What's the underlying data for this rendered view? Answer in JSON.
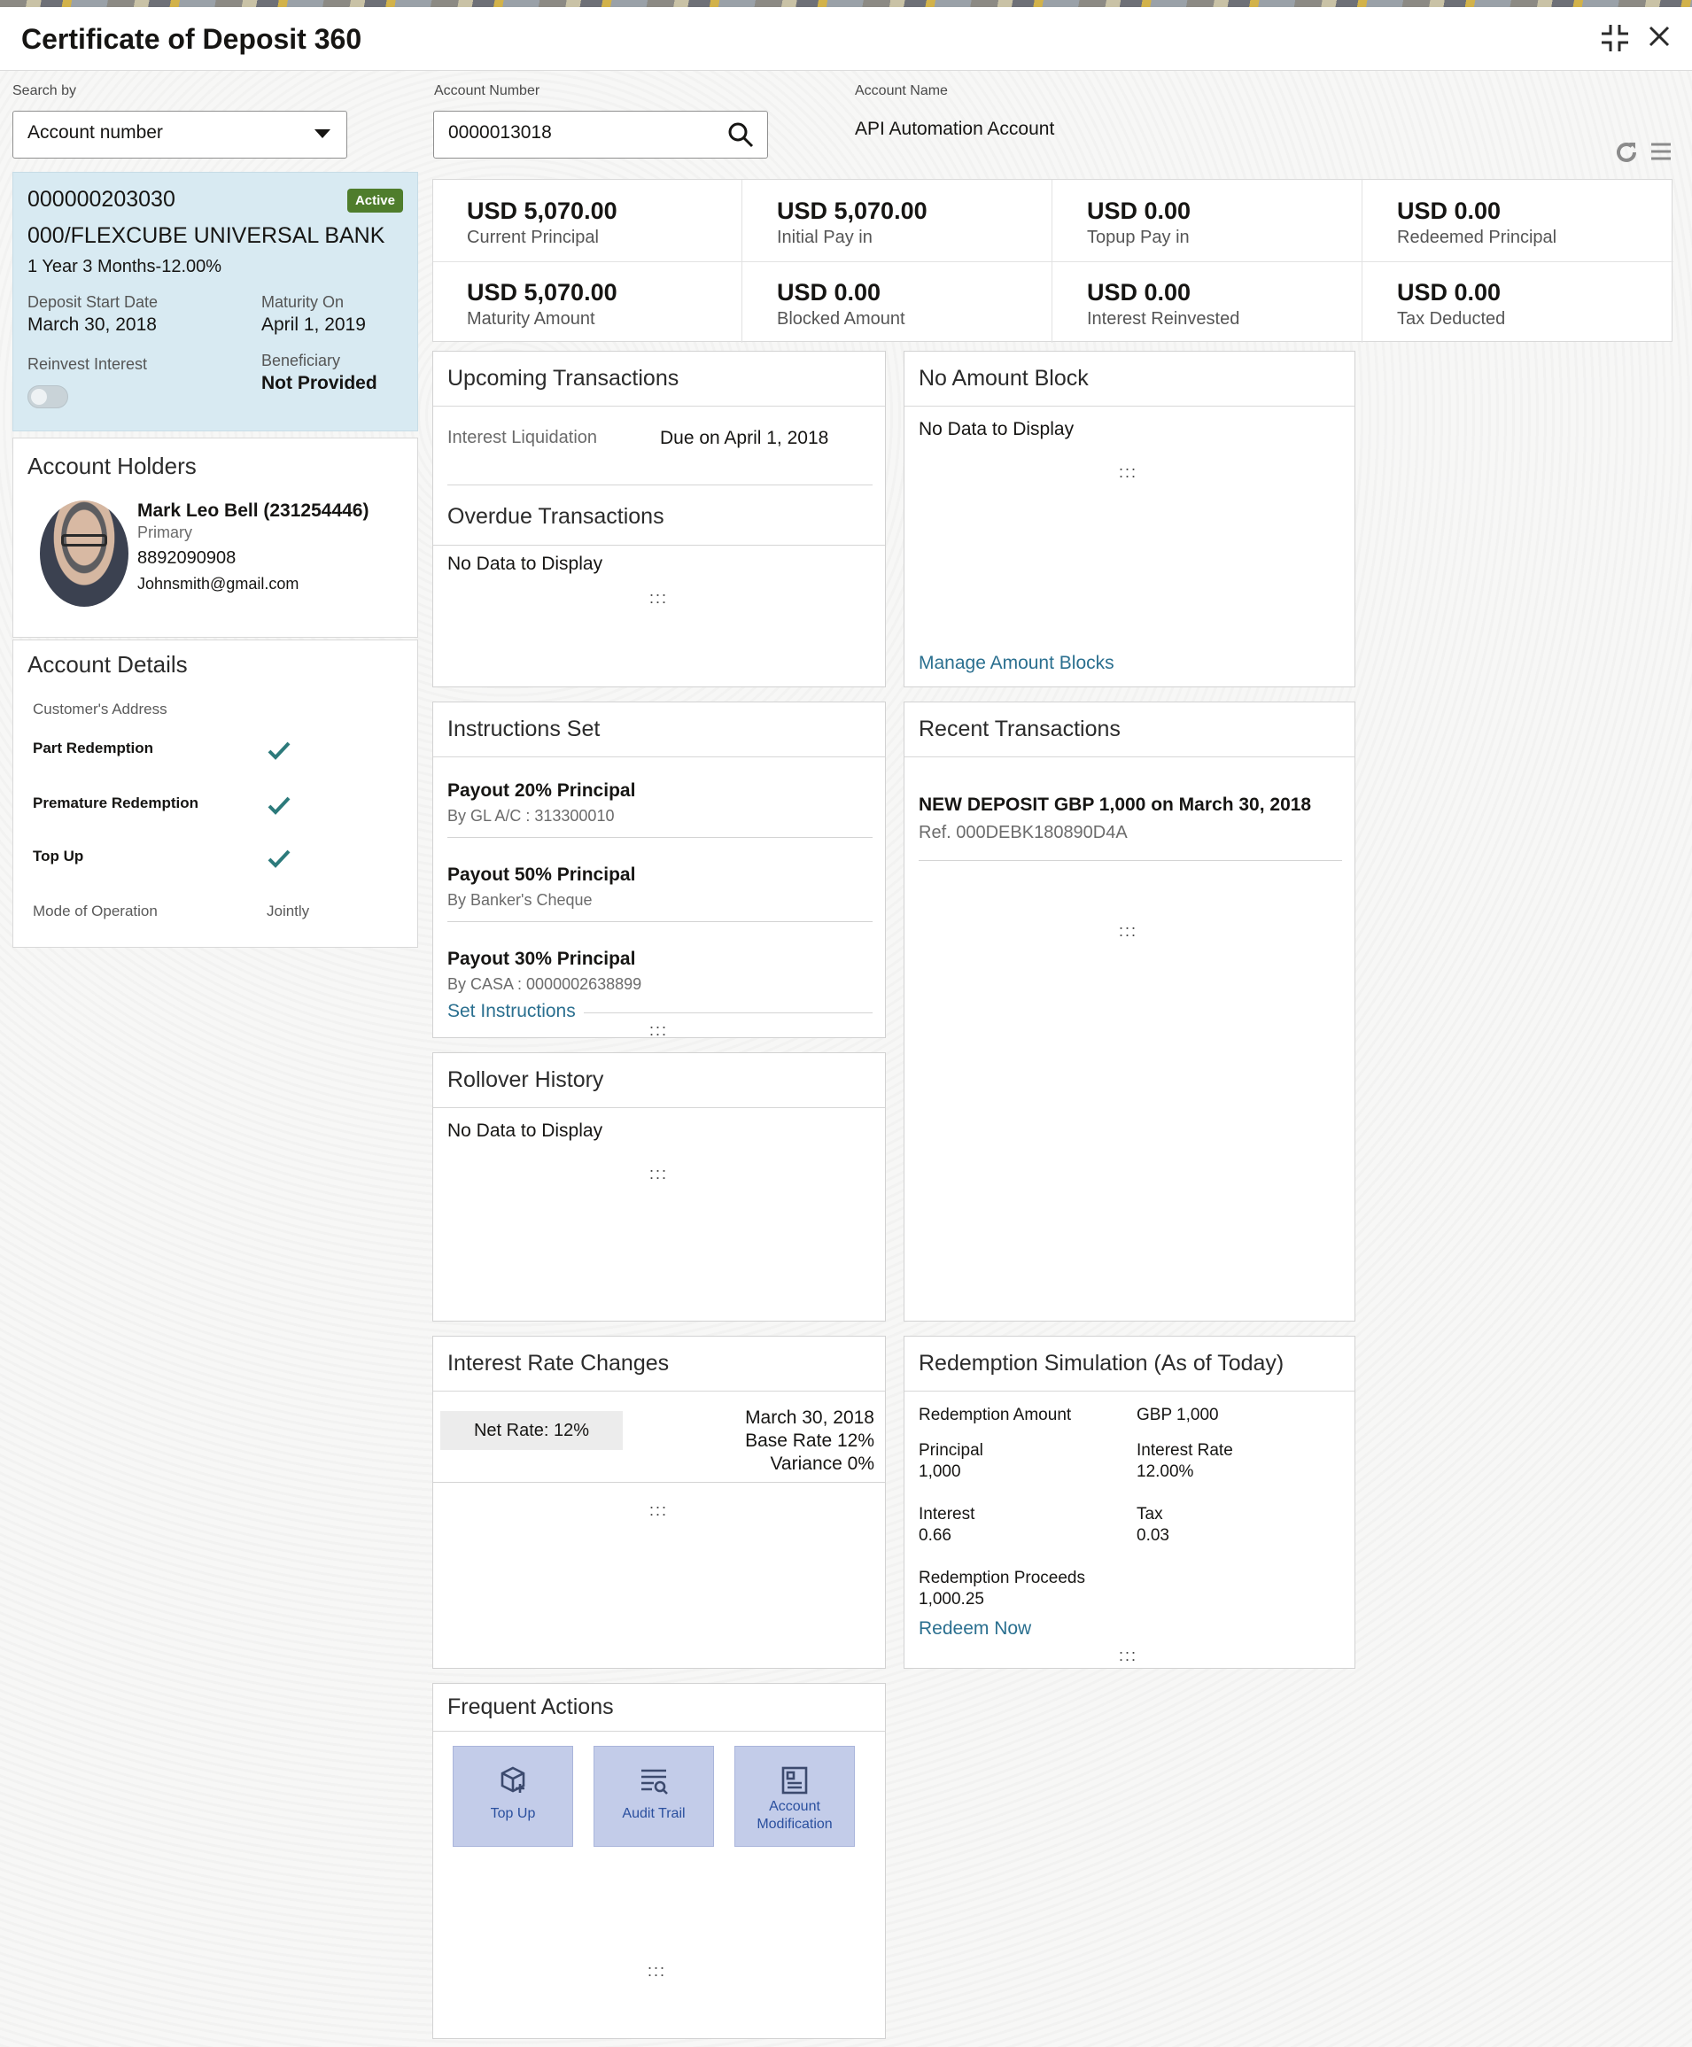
{
  "window": {
    "title": "Certificate of Deposit 360",
    "minimize_icon": "collapse-icon",
    "close_icon": "close-icon"
  },
  "search": {
    "search_by_label": "Search by",
    "search_by_value": "Account number",
    "account_number_label": "Account Number",
    "account_number_value": "0000013018",
    "account_name_label": "Account Name",
    "account_name_value": "API Automation Account"
  },
  "summary": {
    "account_no": "000000203030",
    "status": "Active",
    "bank": "000/FLEXCUBE UNIVERSAL BANK",
    "product": "1 Year 3 Months-12.00%",
    "start_label": "Deposit Start Date",
    "start_value": "March 30, 2018",
    "maturity_label": "Maturity On",
    "maturity_value": "April 1, 2019",
    "reinvest_label": "Reinvest Interest",
    "beneficiary_label": "Beneficiary",
    "beneficiary_value": "Not Provided"
  },
  "holders": {
    "title": "Account Holders",
    "name": "Mark Leo Bell (231254446)",
    "role": "Primary",
    "phone": "8892090908",
    "email": "Johnsmith@gmail.com"
  },
  "details": {
    "title": "Account Details",
    "address_label": "Customer's Address",
    "items": [
      {
        "label": "Part Redemption"
      },
      {
        "label": "Premature Redemption"
      },
      {
        "label": "Top Up"
      }
    ],
    "mode_label": "Mode of Operation",
    "mode_value": "Jointly"
  },
  "kpis": [
    {
      "value": "USD 5,070.00",
      "label": "Current Principal"
    },
    {
      "value": "USD 5,070.00",
      "label": "Initial Pay in"
    },
    {
      "value": "USD 0.00",
      "label": "Topup Pay in"
    },
    {
      "value": "USD 0.00",
      "label": "Redeemed Principal"
    },
    {
      "value": "USD 5,070.00",
      "label": "Maturity Amount"
    },
    {
      "value": "USD 0.00",
      "label": "Blocked Amount"
    },
    {
      "value": "USD 0.00",
      "label": "Interest Reinvested"
    },
    {
      "value": "USD 0.00",
      "label": "Tax Deducted"
    }
  ],
  "upcoming": {
    "title": "Upcoming Transactions",
    "item_label": "Interest Liquidation",
    "item_value": "Due on April 1, 2018",
    "overdue_title": "Overdue Transactions",
    "overdue_empty": "No Data to Display"
  },
  "amount_block": {
    "title": "No Amount Block",
    "empty": "No Data to Display",
    "link": "Manage Amount Blocks"
  },
  "instructions": {
    "title": "Instructions Set",
    "items": [
      {
        "title": "Payout 20% Principal",
        "sub": "By GL A/C : 313300010"
      },
      {
        "title": "Payout 50% Principal",
        "sub": "By Banker's Cheque"
      },
      {
        "title": "Payout 30% Principal",
        "sub": "By CASA : 0000002638899"
      }
    ],
    "link": "Set Instructions"
  },
  "recent": {
    "title": "Recent Transactions",
    "item_title": "NEW DEPOSIT GBP 1,000 on March 30, 2018",
    "item_ref": "Ref. 000DEBK180890D4A"
  },
  "rollover": {
    "title": "Rollover History",
    "empty": "No Data to Display"
  },
  "interest_rate": {
    "title": "Interest Rate Changes",
    "net_rate": "Net Rate: 12%",
    "date": "March 30, 2018",
    "base_rate": "Base Rate 12%",
    "variance": "Variance 0%"
  },
  "redemption": {
    "title": "Redemption Simulation (As of Today)",
    "amount_label": "Redemption Amount",
    "amount_value": "GBP 1,000",
    "principal_label": "Principal",
    "principal_value": "1,000",
    "rate_label": "Interest Rate",
    "rate_value": "12.00%",
    "interest_label": "Interest",
    "interest_value": "0.66",
    "tax_label": "Tax",
    "tax_value": "0.03",
    "proceeds_label": "Redemption Proceeds",
    "proceeds_value": "1,000.25",
    "link": "Redeem Now"
  },
  "frequent": {
    "title": "Frequent Actions",
    "actions": [
      {
        "label": "Top Up",
        "icon": "top-up-icon"
      },
      {
        "label": "Audit Trail",
        "icon": "audit-trail-icon"
      },
      {
        "label": "Account Modification",
        "icon": "account-modification-icon"
      }
    ]
  },
  "dots": ":::"
}
